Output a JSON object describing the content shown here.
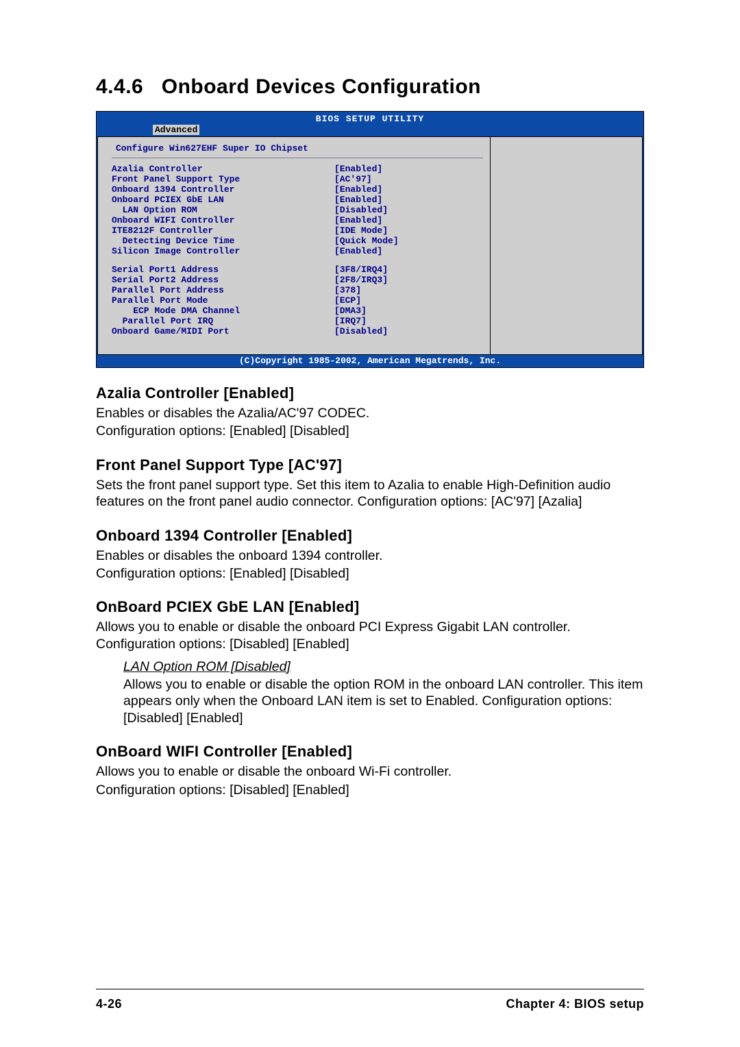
{
  "page": {
    "section_number": "4.4.6",
    "section_title": "Onboard Devices Configuration",
    "footer_left": "4-26",
    "footer_right": "Chapter 4: BIOS setup"
  },
  "bios": {
    "title": "BIOS SETUP UTILITY",
    "tab": "Advanced",
    "subtitle": "Configure Win627EHF Super IO Chipset",
    "group1": [
      {
        "label": "Azalia Controller",
        "value": "[Enabled]"
      },
      {
        "label": "Front Panel Support Type",
        "value": "[AC'97]"
      },
      {
        "label": "Onboard 1394 Controller",
        "value": "[Enabled]"
      },
      {
        "label": "Onboard PCIEX GbE LAN",
        "value": "[Enabled]"
      },
      {
        "label": "  LAN Option ROM",
        "value": "[Disabled]"
      },
      {
        "label": "Onboard WIFI Controller",
        "value": "[Enabled]"
      },
      {
        "label": "ITE8212F Controller",
        "value": "[IDE Mode]"
      },
      {
        "label": "  Detecting Device Time",
        "value": "[Quick Mode]"
      },
      {
        "label": "Silicon Image Controller",
        "value": "[Enabled]"
      }
    ],
    "group2": [
      {
        "label": "Serial Port1 Address",
        "value": "[3F8/IRQ4]"
      },
      {
        "label": "Serial Port2 Address",
        "value": "[2F8/IRQ3]"
      },
      {
        "label": "Parallel Port Address",
        "value": "[378]"
      },
      {
        "label": "Parallel Port Mode",
        "value": "[ECP]"
      },
      {
        "label": "    ECP Mode DMA Channel",
        "value": "[DMA3]"
      },
      {
        "label": "  Parallel Port IRQ",
        "value": "[IRQ7]"
      },
      {
        "label": "Onboard Game/MIDI Port",
        "value": "[Disabled]"
      }
    ],
    "copyright": "(C)Copyright 1985-2002, American Megatrends, Inc."
  },
  "sections": [
    {
      "heading": "Azalia Controller [Enabled]",
      "paras": [
        "Enables or disables the Azalia/AC'97 CODEC.",
        "Configuration options: [Enabled] [Disabled]"
      ]
    },
    {
      "heading": "Front Panel Support Type [AC'97]",
      "paras": [
        "Sets the front panel support type. Set this item to Azalia to enable High-Definition audio features on the front panel audio connector. Configuration options: [AC'97] [Azalia]"
      ]
    },
    {
      "heading": "Onboard 1394 Controller [Enabled]",
      "paras": [
        "Enables or disables the onboard 1394 controller.",
        "Configuration options: [Enabled] [Disabled]"
      ]
    },
    {
      "heading": "OnBoard PCIEX GbE LAN [Enabled]",
      "paras": [
        "Allows you to enable or disable the onboard PCI Express Gigabit LAN controller.  Configuration options: [Disabled] [Enabled]"
      ],
      "sub": {
        "heading": "LAN Option ROM [Disabled]",
        "paras": [
          "Allows you to enable or disable the option ROM in the onboard LAN controller. This item appears only when the Onboard LAN item is set to Enabled. Configuration options: [Disabled] [Enabled]"
        ]
      }
    },
    {
      "heading": "OnBoard WIFI Controller [Enabled]",
      "paras": [
        "Allows you to enable or disable the onboard Wi-Fi controller.",
        "Configuration options: [Disabled] [Enabled]"
      ]
    }
  ]
}
